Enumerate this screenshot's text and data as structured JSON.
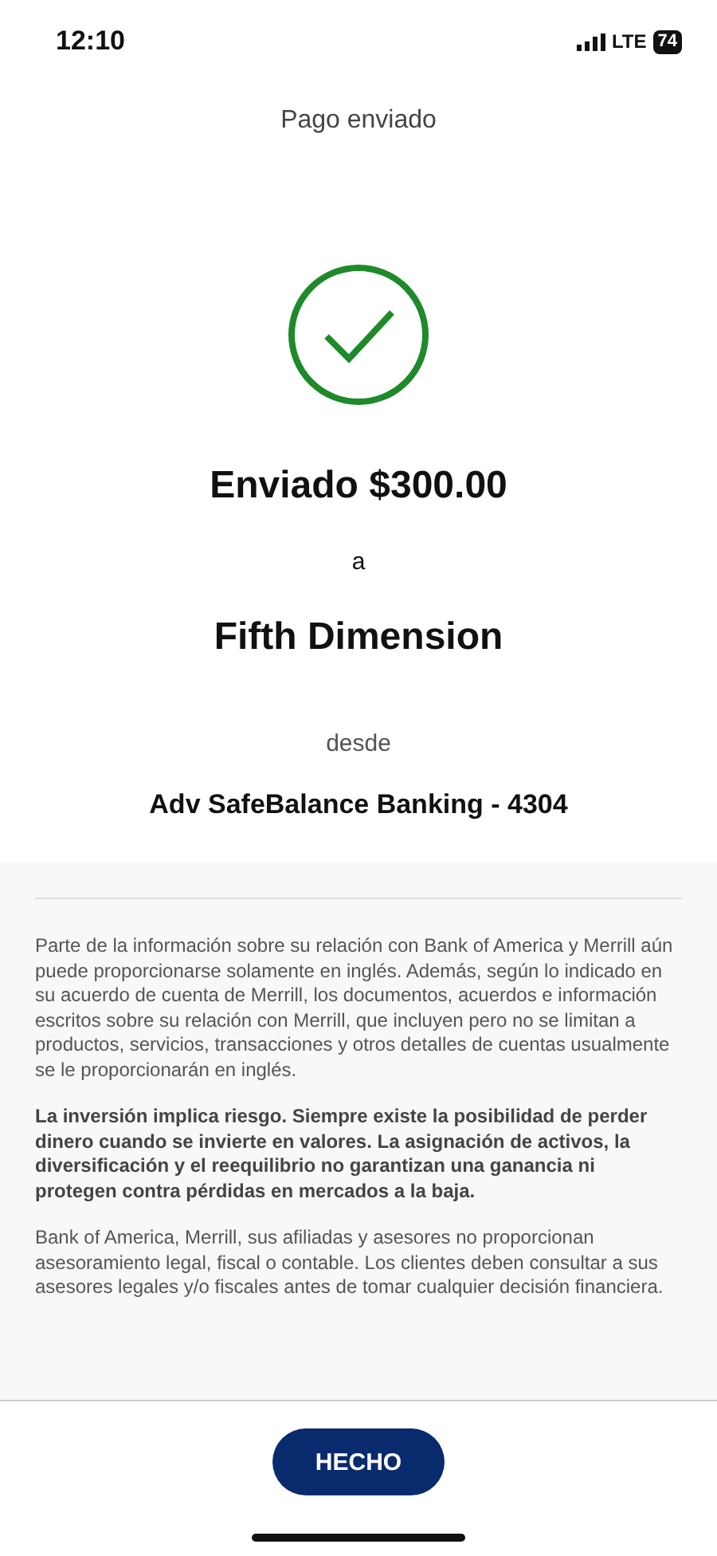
{
  "status_bar": {
    "time": "12:10",
    "network": "LTE",
    "battery": "74"
  },
  "header": {
    "title": "Pago enviado"
  },
  "confirmation": {
    "amount_line": "Enviado $300.00",
    "connector": "a",
    "recipient": "Fifth Dimension",
    "from_label": "desde",
    "account": "Adv SafeBalance Banking - 4304"
  },
  "disclosures": [
    {
      "kind": "normal",
      "text": "Parte de la información sobre su relación con Bank of America y Merrill aún puede proporcionarse solamente en inglés. Además, según lo indicado en su acuerdo de cuenta de Merrill, los documentos, acuerdos e información escritos sobre su relación con Merrill, que incluyen pero no se limitan a productos, servicios, transacciones y otros detalles de cuentas usualmente se le proporcionarán en inglés."
    },
    {
      "kind": "bold",
      "text": "La inversión implica riesgo. Siempre existe la posibilidad de perder dinero cuando se invierte en valores. La asignación de activos, la diversificación y el reequilibrio no garantizan una ganancia ni protegen contra pérdidas en mercados a la baja."
    },
    {
      "kind": "normal",
      "text": "Bank of America, Merrill, sus afiliadas y asesores no proporcionan asesoramiento legal, fiscal o contable. Los clientes deben consultar a sus asesores legales y/o fiscales antes de tomar cualquier decisión financiera."
    }
  ],
  "done_button": {
    "label": "HECHO"
  }
}
